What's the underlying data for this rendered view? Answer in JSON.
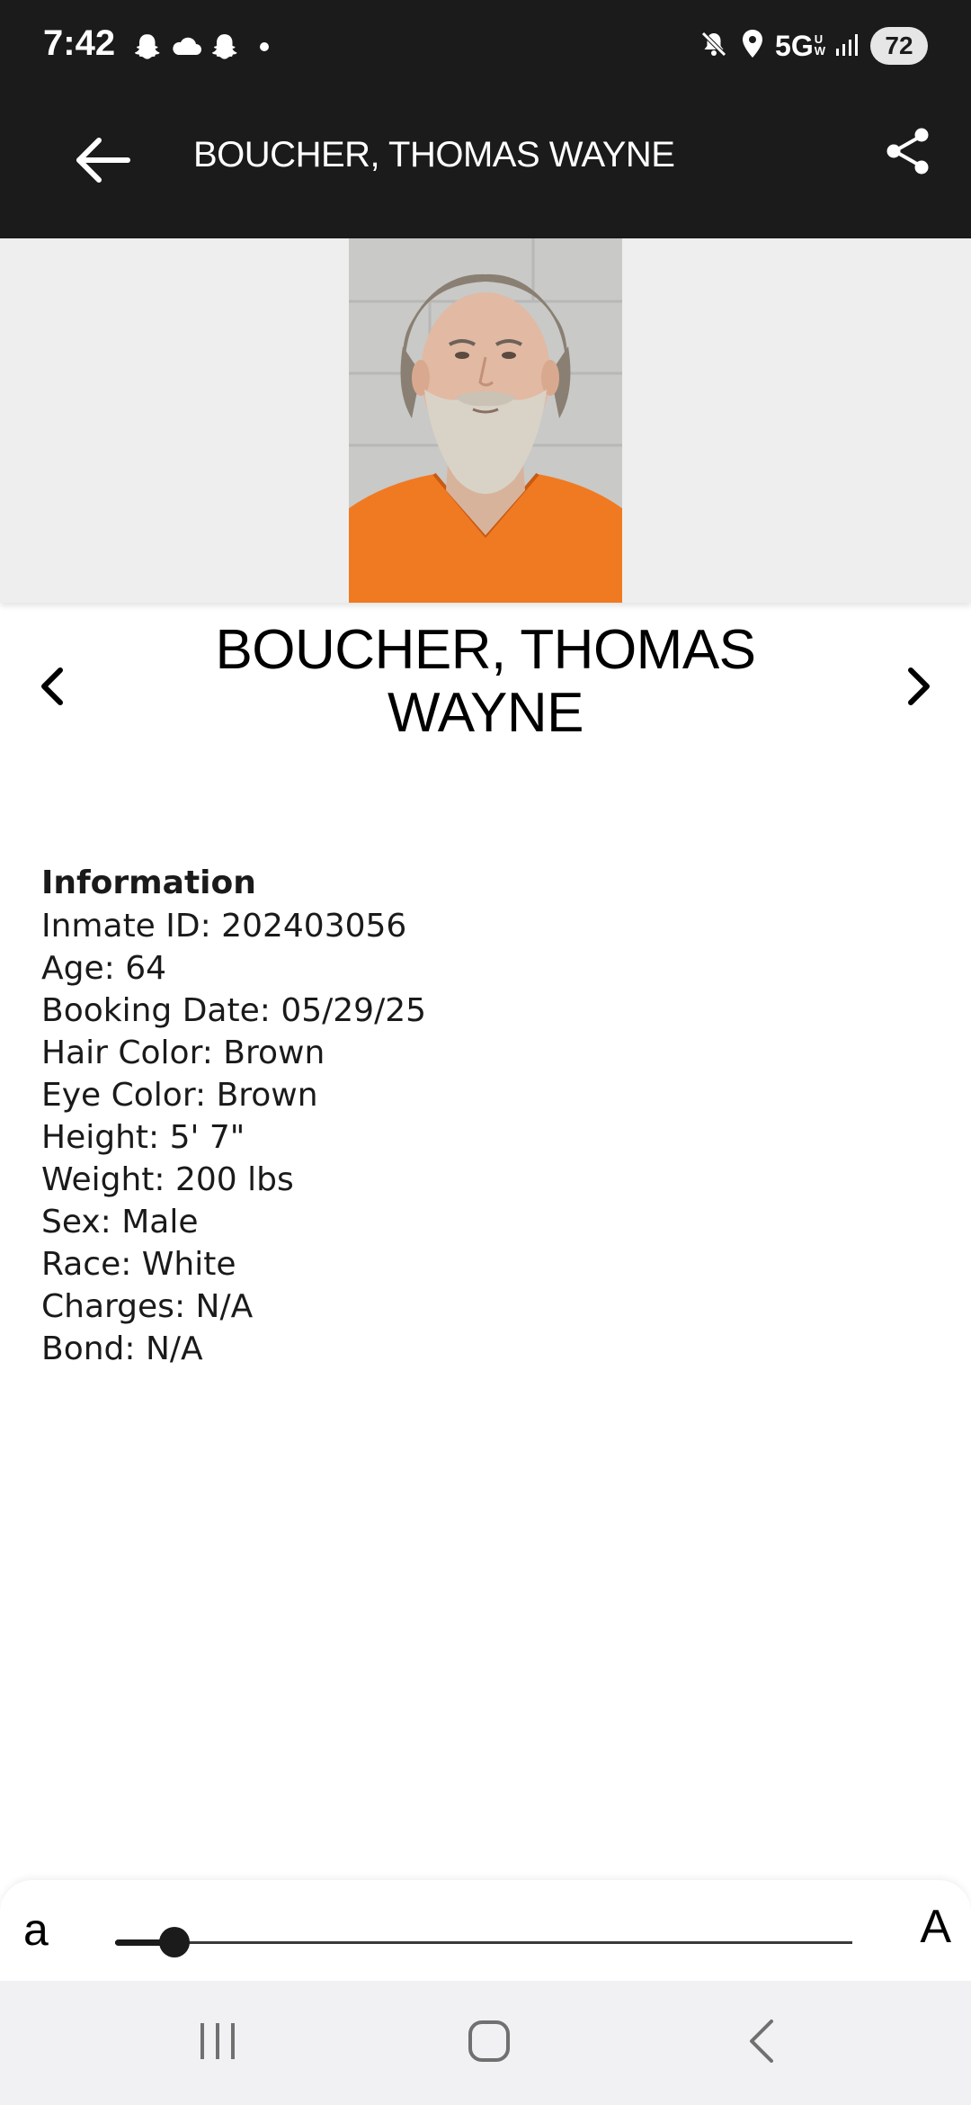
{
  "status_bar": {
    "time": "7:42",
    "left_icons": [
      "snapchat-icon",
      "cloud-icon",
      "snapchat-icon",
      "notification-dot-icon"
    ],
    "right_icons": [
      "mute-icon",
      "location-icon"
    ],
    "network": "5G",
    "network_sub": [
      "U",
      "W"
    ],
    "battery": "72"
  },
  "app_bar": {
    "title": "BOUCHER, THOMAS WAYNE",
    "back_icon": "arrow-left-icon",
    "share_icon": "share-icon"
  },
  "record": {
    "name": "BOUCHER, THOMAS WAYNE",
    "info_heading": "Information",
    "fields": [
      {
        "label": "Inmate ID",
        "value": "202403056",
        "text": "Inmate ID: 202403056"
      },
      {
        "label": "Age",
        "value": "64",
        "text": "Age: 64"
      },
      {
        "label": "Booking Date",
        "value": "05/29/25",
        "text": "Booking Date: 05/29/25"
      },
      {
        "label": "Hair Color",
        "value": "Brown",
        "text": "Hair Color: Brown"
      },
      {
        "label": "Eye Color",
        "value": "Brown",
        "text": "Eye Color: Brown"
      },
      {
        "label": "Height",
        "value": "5' 7\"",
        "text": "Height: 5' 7\""
      },
      {
        "label": "Weight",
        "value": "200 lbs",
        "text": "Weight: 200 lbs"
      },
      {
        "label": "Sex",
        "value": "Male",
        "text": "Sex: Male"
      },
      {
        "label": "Race",
        "value": "White",
        "text": "Race: White"
      },
      {
        "label": "Charges",
        "value": "N/A",
        "text": "Charges: N/A"
      },
      {
        "label": "Bond",
        "value": "N/A",
        "text": "Bond: N/A"
      }
    ]
  },
  "text_size": {
    "small_label": "a",
    "large_label": "A",
    "level": 0.08
  },
  "nav_bar": {
    "buttons": [
      "recent-apps-icon",
      "home-icon",
      "back-icon"
    ]
  },
  "colors": {
    "app_bar": "#1b1b1b",
    "photo_band": "#eeeeee",
    "jumpsuit": "#f07a22",
    "nav_bar": "#f1f1f3"
  }
}
